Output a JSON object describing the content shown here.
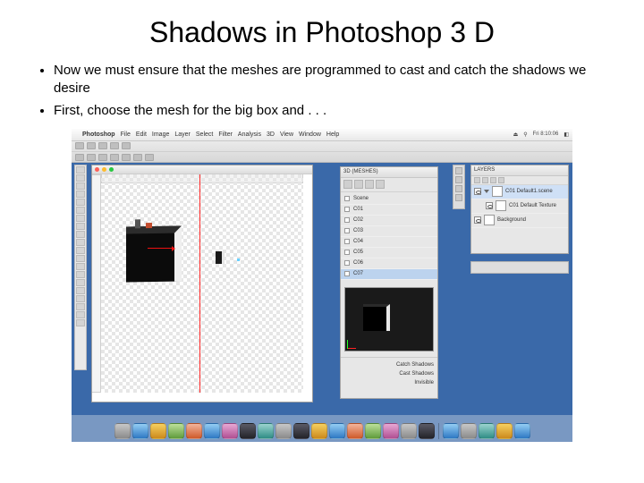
{
  "slide": {
    "title": "Shadows in Photoshop 3 D",
    "bullets": [
      "Now we must ensure that the meshes are programmed to cast and catch the shadows we desire",
      "First, choose the mesh for the big box and . . ."
    ]
  },
  "menubar": {
    "app": "Photoshop",
    "items": [
      "File",
      "Edit",
      "Image",
      "Layer",
      "Select",
      "Filter",
      "Analysis",
      "3D",
      "View",
      "Window",
      "Help"
    ],
    "right": [
      "⏏",
      "⚲",
      "Fri 8:10:06",
      "◧"
    ]
  },
  "panel3d": {
    "tab": "3D (MESHES)",
    "rows": [
      "Scene",
      "C01",
      "C02",
      "C03",
      "C04",
      "C05",
      "C06",
      "C07"
    ],
    "selectedIndex": 7,
    "sub": {
      "r1": "Catch Shadows",
      "r2": "Cast Shadows",
      "r3": "Invisible"
    }
  },
  "layers": {
    "tab": "LAYERS",
    "items": [
      "C01  Default1.scene",
      "Background"
    ],
    "sublabel": "C01  Default Texture"
  }
}
